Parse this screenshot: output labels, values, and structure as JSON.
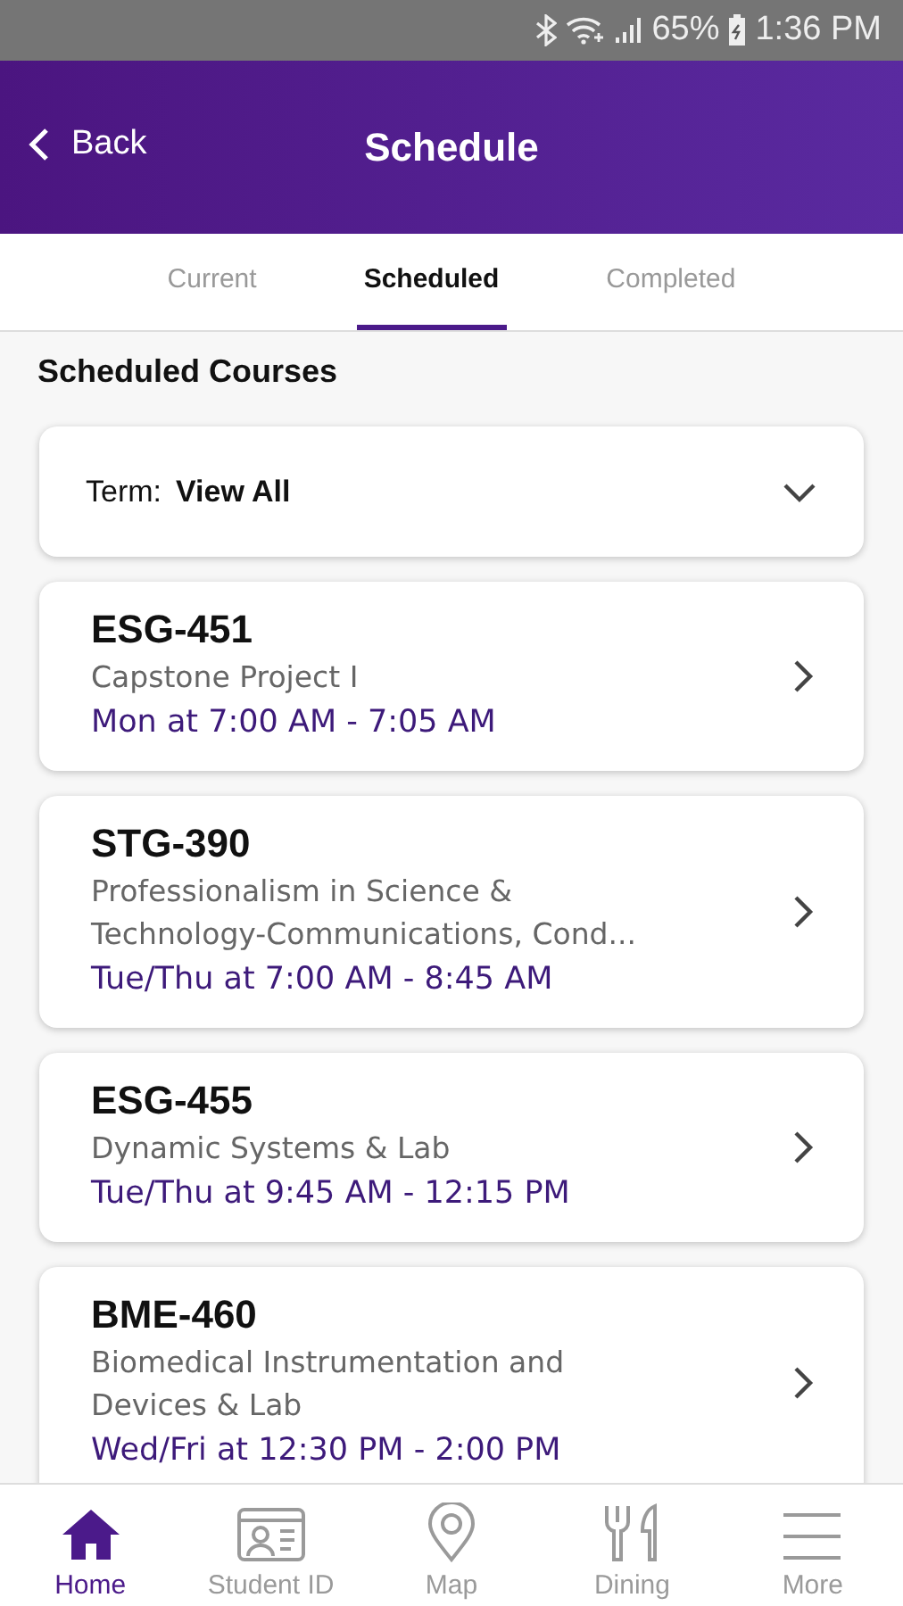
{
  "status_bar": {
    "battery": "65%",
    "time": "1:36 PM"
  },
  "header": {
    "back": "Back",
    "title": "Schedule"
  },
  "tabs": [
    {
      "label": "Current",
      "selected": false
    },
    {
      "label": "Scheduled",
      "selected": true
    },
    {
      "label": "Completed",
      "selected": false
    }
  ],
  "section_title": "Scheduled Courses",
  "term_filter": {
    "label": "Term:",
    "value": "View All"
  },
  "courses": [
    {
      "code": "ESG-451",
      "name": "Capstone Project I",
      "time": "Mon at 7:00 AM - 7:05 AM"
    },
    {
      "code": "STG-390",
      "name": "Professionalism in Science & Technology-Communications, Cond...",
      "time": "Tue/Thu at 7:00 AM - 8:45 AM"
    },
    {
      "code": "ESG-455",
      "name": "Dynamic Systems & Lab",
      "time": "Tue/Thu at 9:45 AM - 12:15 PM"
    },
    {
      "code": "BME-460",
      "name": "Biomedical Instrumentation and Devices & Lab",
      "time": "Wed/Fri at 12:30 PM - 2:00 PM"
    }
  ],
  "bottom_nav": [
    {
      "label": "Home",
      "selected": true
    },
    {
      "label": "Student ID",
      "selected": false
    },
    {
      "label": "Map",
      "selected": false
    },
    {
      "label": "Dining",
      "selected": false
    },
    {
      "label": "More",
      "selected": false
    }
  ]
}
